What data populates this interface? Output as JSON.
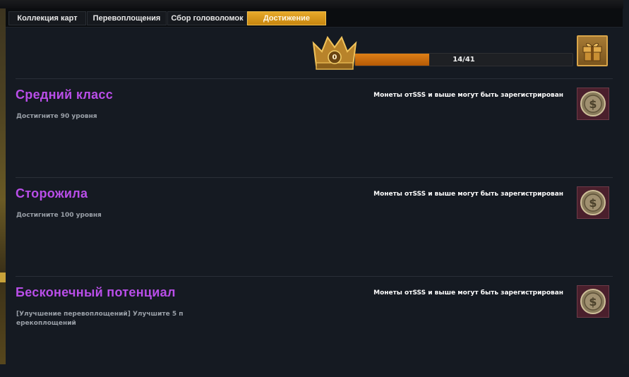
{
  "tabs": [
    {
      "label": "Коллекция карт",
      "active": false
    },
    {
      "label": "Перевоплощения",
      "active": false
    },
    {
      "label": "Сбор головоломок",
      "active": false
    },
    {
      "label": "Достижение",
      "active": true
    }
  ],
  "progress": {
    "crown_value": "0",
    "text": "14/41",
    "current": 14,
    "total": 41
  },
  "achievements": [
    {
      "title": "Средний класс",
      "description": "Достигните 90 уровня",
      "note": "Монеты отSSS и выше могут быть зарегистрирован",
      "reward_icon": "coin-icon"
    },
    {
      "title": "Сторожила",
      "description": "Достигните 100 уровня",
      "note": "Монеты отSSS и выше могут быть зарегистрирован",
      "reward_icon": "coin-icon"
    },
    {
      "title": "Бесконечный потенциал",
      "description": "[Улучшение перевоплощений] Улучшите 5 п ерекоплощений",
      "note": "Монеты отSSS и выше могут быть зарегистрирован",
      "reward_icon": "coin-icon"
    }
  ],
  "colors": {
    "title": "#b94ee9",
    "active_tab": "#e7a92a",
    "progress_fill": "#de7f16",
    "panel": "#151a22"
  }
}
